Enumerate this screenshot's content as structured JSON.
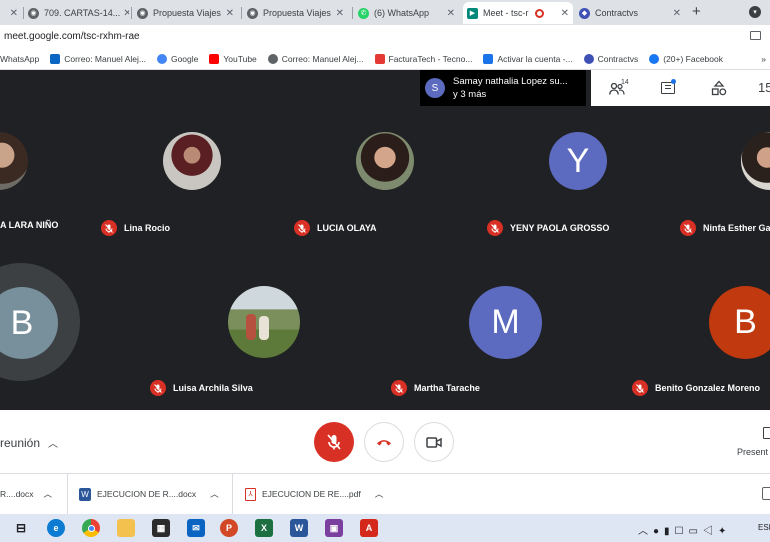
{
  "browser": {
    "tabs": [
      {
        "label": "",
        "active": false
      },
      {
        "label": "709. CARTAS-14...",
        "active": false
      },
      {
        "label": "Propuesta Viajes",
        "active": false
      },
      {
        "label": "Propuesta Viajes",
        "active": false
      },
      {
        "label": "(6) WhatsApp",
        "active": false
      },
      {
        "label": "Meet - tsc-r",
        "active": true
      },
      {
        "label": "Contractvs",
        "active": false
      }
    ],
    "new_tab": "+",
    "url": "meet.google.com/tsc-rxhm-rae",
    "bookmarks": [
      {
        "label": "WhatsApp",
        "color": "#25d366"
      },
      {
        "label": "Correo: Manuel Alej...",
        "color": "#0a66c2"
      },
      {
        "label": "Google",
        "color": "#4285f4"
      },
      {
        "label": "YouTube",
        "color": "#ff0000"
      },
      {
        "label": "Correo: Manuel Alej...",
        "color": "#5f6368"
      },
      {
        "label": "FacturaTech - Tecno...",
        "color": "#e53935"
      },
      {
        "label": "Activar la cuenta -...",
        "color": "#1a73e8"
      },
      {
        "label": "Contractvs",
        "color": "#3f51b5"
      },
      {
        "label": "(20+) Facebook",
        "color": "#1877f2"
      }
    ],
    "more_bookmarks": "»"
  },
  "meet": {
    "presenter_toast": {
      "initial": "S",
      "line1": "Samay nathalia Lopez su...",
      "line2": "y 3 más"
    },
    "people_count": "14",
    "partial_count": "15",
    "participants_row1": [
      {
        "name": "A LARA NIÑO",
        "kind": "photo"
      },
      {
        "name": "Lina Rocio",
        "kind": "photo"
      },
      {
        "name": "LUCIA OLAYA",
        "kind": "photo"
      },
      {
        "name": "YENY PAOLA GROSSO",
        "kind": "avatar",
        "initial": "Y",
        "color": "#5c6bc0"
      },
      {
        "name": "Ninfa Esther Ga",
        "kind": "photo"
      }
    ],
    "participants_row2": [
      {
        "name": "",
        "kind": "avatar",
        "initial": "B",
        "color": "#78909c"
      },
      {
        "name": "Luisa Archila Silva",
        "kind": "photo"
      },
      {
        "name": "Martha Tarache",
        "kind": "avatar",
        "initial": "M",
        "color": "#5c6bc0"
      },
      {
        "name": "Benito Gonzalez Moreno",
        "kind": "avatar",
        "initial": "B",
        "color": "#c0390f"
      }
    ],
    "meeting_details_label": "reunión",
    "present_label": "Present"
  },
  "downloads": [
    {
      "label": "R....docx",
      "type": "word"
    },
    {
      "label": "EJECUCION DE R....docx",
      "type": "word"
    },
    {
      "label": "EJECUCION DE RE....pdf",
      "type": "pdf"
    }
  ],
  "taskbar": {
    "lang": "ESI"
  }
}
